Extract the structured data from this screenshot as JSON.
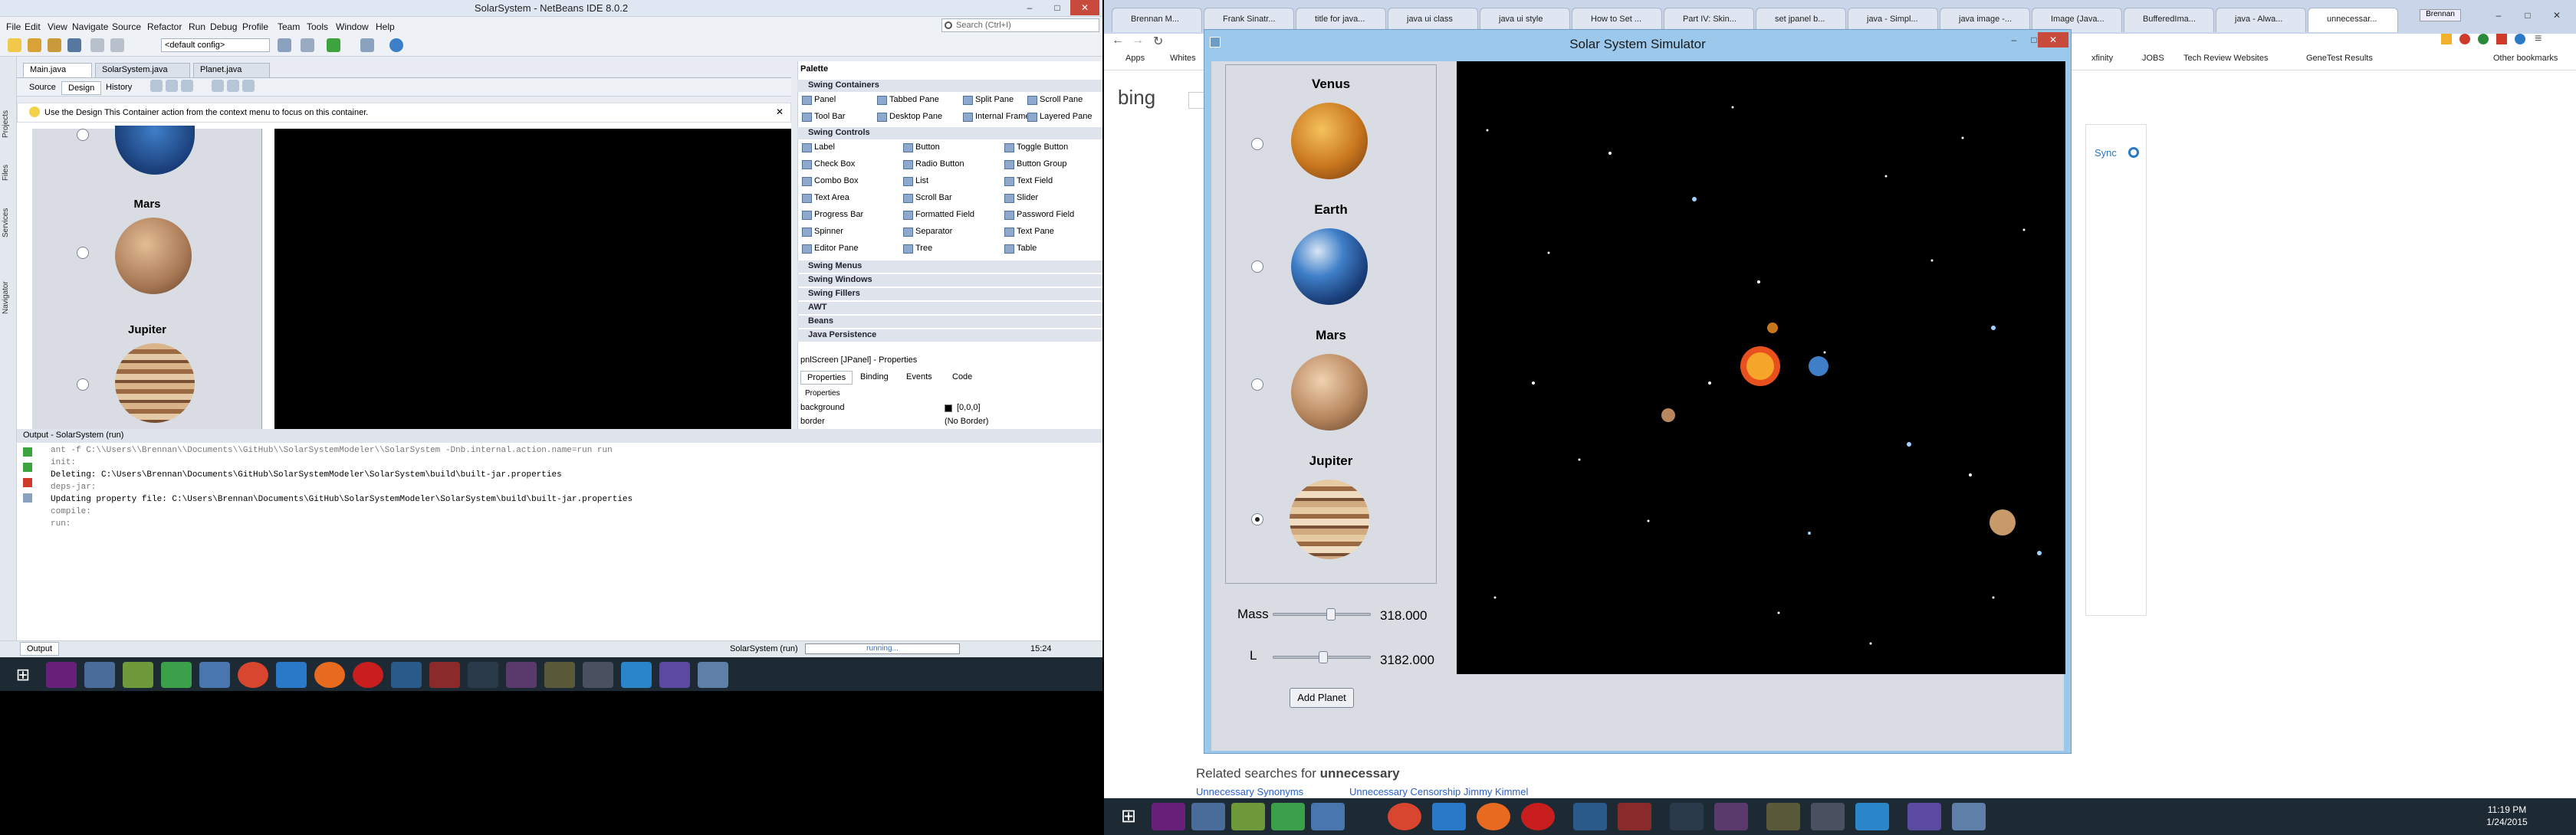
{
  "netbeans": {
    "title": "SolarSystem - NetBeans IDE 8.0.2",
    "menus": [
      "File",
      "Edit",
      "View",
      "Navigate",
      "Source",
      "Refactor",
      "Run",
      "Debug",
      "Profile",
      "Team",
      "Tools",
      "Window",
      "Help"
    ],
    "search_placeholder": "Search (Ctrl+I)",
    "config": "<default config>",
    "side_tabs": [
      "Projects",
      "Files",
      "Services",
      "Navigator"
    ],
    "editor_tabs": [
      "Main.java",
      "SolarSystem.java",
      "Planet.java"
    ],
    "design_tabs": [
      "Source",
      "Design",
      "History"
    ],
    "hint": "Use the Design This Container action from the context menu to focus on this container.",
    "designer_planets": [
      "Mars",
      "Jupiter"
    ],
    "palette": {
      "title": "Palette",
      "swing_containers": "Swing Containers",
      "containers": [
        "Panel",
        "Tabbed Pane",
        "Split Pane",
        "Scroll Pane",
        "Tool Bar",
        "Desktop Pane",
        "Internal Frame",
        "Layered Pane"
      ],
      "swing_controls": "Swing Controls",
      "controls": [
        "Label",
        "Button",
        "Toggle Button",
        "Check Box",
        "Radio Button",
        "Button Group",
        "Combo Box",
        "List",
        "Text Field",
        "Text Area",
        "Scroll Bar",
        "Slider",
        "Progress Bar",
        "Formatted Field",
        "Password Field",
        "Spinner",
        "Separator",
        "Text Pane",
        "Editor Pane",
        "Tree",
        "Table"
      ],
      "more": [
        "Swing Menus",
        "Swing Windows",
        "Swing Fillers",
        "AWT",
        "Beans",
        "Java Persistence"
      ]
    },
    "properties": {
      "title": "pnlScreen [JPanel] - Properties",
      "tabs": [
        "Properties",
        "Binding",
        "Events",
        "Code"
      ],
      "section": "Properties",
      "rows": [
        {
          "name": "background",
          "value": "[0,0,0]"
        },
        {
          "name": "border",
          "value": "(No Border)"
        }
      ]
    },
    "output": {
      "title": "Output - SolarSystem (run)",
      "lines": [
        "ant -f C:\\\\Users\\\\Brennan\\\\Documents\\\\GitHub\\\\SolarSystemModeler\\\\SolarSystem -Dnb.internal.action.name=run run",
        "init:",
        "Deleting: C:\\Users\\Brennan\\Documents\\GitHub\\SolarSystemModeler\\SolarSystem\\build\\built-jar.properties",
        "deps-jar:",
        "Updating property file: C:\\Users\\Brennan\\Documents\\GitHub\\SolarSystemModeler\\SolarSystem\\build\\built-jar.properties",
        "compile:",
        "run:"
      ]
    },
    "status": {
      "project": "SolarSystem (run)",
      "state": "running...",
      "time": "15:24",
      "output_tab": "Output"
    }
  },
  "chrome": {
    "tabs": [
      "Brennan M...",
      "Frank Sinatr...",
      "title for java...",
      "java ui class",
      "java ui style",
      "How to Set ...",
      "Part IV: Skin...",
      "set jpanel b...",
      "java - Simpl...",
      "java image -...",
      "Image (Java...",
      "BufferedIma...",
      "java - Alwa...",
      "unnecessar..."
    ],
    "profile": "Brennan",
    "bookmarks": [
      "Apps",
      "Whites",
      "xfinity",
      "JOBS",
      "Tech Review Websites",
      "GeneTest Results",
      "Other bookmarks"
    ],
    "bing_logo": "bing",
    "sync": "Sync",
    "related_prefix": "Related searches for ",
    "related_term": "unnecessary",
    "related": [
      "Unnecessary Synonyms",
      "Unnecessary Censorship Jimmy Kimmel"
    ]
  },
  "solar": {
    "title": "Solar System Simulator",
    "planets": [
      {
        "name": "Venus",
        "selected": false
      },
      {
        "name": "Earth",
        "selected": false
      },
      {
        "name": "Mars",
        "selected": false
      },
      {
        "name": "Jupiter",
        "selected": true
      }
    ],
    "mass_label": "Mass",
    "mass_value": "318.000",
    "l_label": "L",
    "l_value": "3182.000",
    "add_button": "Add Planet"
  },
  "taskbar_right": {
    "time": "11:19 PM",
    "date": "1/24/2015"
  }
}
